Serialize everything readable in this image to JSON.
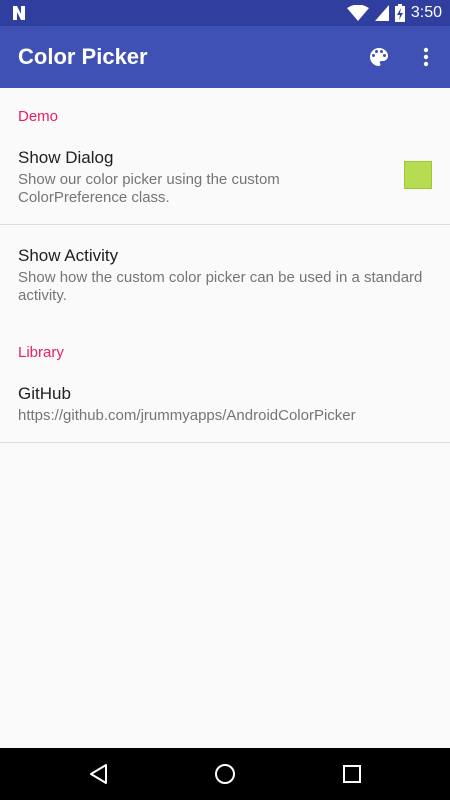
{
  "status_bar": {
    "time": "3:50",
    "icons": [
      "notification-n-icon",
      "wifi-icon",
      "signal-icon",
      "battery-charging-icon"
    ]
  },
  "app_bar": {
    "title": "Color Picker",
    "actions": [
      "palette-icon",
      "overflow-menu-icon"
    ]
  },
  "colors": {
    "status_bar": "#303f9f",
    "app_bar": "#3f51b5",
    "category_accent": "#e91e63",
    "swatch": "#b5dc52"
  },
  "sections": [
    {
      "header": "Demo",
      "items": [
        {
          "title": "Show Dialog",
          "summary_line1": "Show our color picker using the custom",
          "summary_line2": "ColorPreference class."
        },
        {
          "title": "Show Activity",
          "summary_line1": "Show how the custom color picker can be used in a standard",
          "summary_line2": "activity."
        }
      ]
    },
    {
      "header": "Library",
      "items": [
        {
          "title": "GitHub",
          "summary_line1": "https://github.com/jrummyapps/AndroidColorPicker"
        }
      ]
    }
  ],
  "nav_bar": [
    "back-icon",
    "home-icon",
    "recents-icon"
  ]
}
